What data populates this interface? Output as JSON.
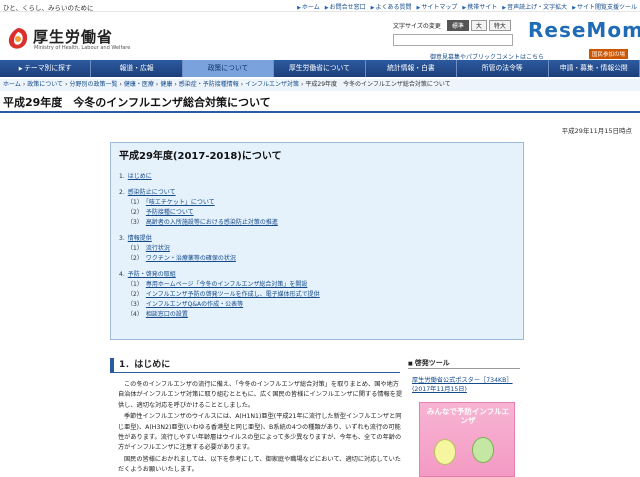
{
  "topbar": {
    "tagline": "ひと、くらし、みらいのために",
    "links": [
      "ホーム",
      "お問合せ窓口",
      "よくある質問",
      "サイトマップ",
      "携帯サイト",
      "音声読上げ・文字拡大",
      "サイト閲覧支援ツール"
    ]
  },
  "header": {
    "title": "厚生労働省",
    "subtitle": "Ministry of Health, Labour and Welfare",
    "font_size_label": "文字サイズの変更",
    "font_sizes": [
      "標準",
      "大",
      "特大"
    ],
    "recruit_link": "御意見募集やパブリックコメントはこちら",
    "map_button": "国民参加の場",
    "watermark": "ReseMom"
  },
  "gnav": [
    "テーマ別に探す",
    "報道・広報",
    "政策について",
    "厚生労働省について",
    "統計情報・白書",
    "所管の法令等",
    "申請・募集・情報公開"
  ],
  "breadcrumb": [
    "ホーム",
    "政策について",
    "分野別の政策一覧",
    "健康・医療",
    "健康",
    "感染症・予防接種情報",
    "インフルエンザ対策",
    "平成29年度　今冬のインフルエンザ総合対策について"
  ],
  "page": {
    "title": "平成29年度　今冬のインフルエンザ総合対策について",
    "date": "平成29年11月15日時点"
  },
  "toc": {
    "title": "平成29年度(2017-2018)について",
    "items": [
      {
        "num": "1.",
        "label": "はじめに",
        "level": 1
      },
      {
        "num": "2.",
        "label": "感染防止について",
        "level": 1
      },
      {
        "num": "（1）",
        "label": "「咳エチケット」について",
        "level": 2
      },
      {
        "num": "（2）",
        "label": "予防接種について",
        "level": 2
      },
      {
        "num": "（3）",
        "label": "高齢者の入所施設等における感染防止対策の推進",
        "level": 2
      },
      {
        "num": "3.",
        "label": "情報提供",
        "level": 1
      },
      {
        "num": "（1）",
        "label": "流行状況",
        "level": 2
      },
      {
        "num": "（2）",
        "label": "ワクチン・治療薬等の確保の状況",
        "level": 2
      },
      {
        "num": "4.",
        "label": "予防・啓発の取組",
        "level": 1
      },
      {
        "num": "（1）",
        "label": "専用ホームページ「今冬のインフルエンザ総合対策」を開設",
        "level": 2
      },
      {
        "num": "（2）",
        "label": "インフルエンザ予防の啓発ツールを作成し、電子媒体形式で提供",
        "level": 2
      },
      {
        "num": "（3）",
        "label": "インフルエンザQ&Aの作成・公表等",
        "level": 2
      },
      {
        "num": "（4）",
        "label": "相談窓口の設置",
        "level": 2
      }
    ]
  },
  "section": {
    "heading": "1．はじめに",
    "paragraphs": [
      "この冬のインフルエンザの流行に備え、「今冬のインフルエンザ総合対策」を取りまとめ、国や地方自治体がインフルエンザ対策に取り組むとともに、広く国民の皆様にインフルエンザに関する情報を提供し、適切な対応を呼びかけることとしました。",
      "季節性インフルエンザのウイルスには、A(H1N1)亜型(平成21年に流行した新型インフルエンザと同じ亜型)、A(H3N2)亜型(いわゆる香港型と同じ亜型)、B系統の4つの種類があり、いずれも流行の可能性があります。流行しやすい年齢層はウイルスの型によって多少異なりますが、今年も、全ての年齢の方がインフルエンザに注意する必要があります。",
      "国民の皆様におかれましては、以下を参考にして、御家庭や職場などにおいて、適切に対応していただくようお願いいたします。"
    ]
  },
  "sidebar": {
    "heading": "啓発ツール",
    "link": "厚生労働省公式ポスター［734KB］(2017年11月15日)",
    "poster_text": "みんなで予防インフルエンザ"
  },
  "colors": {
    "nav": "#2c5aa0",
    "nav_active": "#7aa3dd",
    "toc_bg": "#e5f1fb",
    "link": "#134a8a"
  }
}
